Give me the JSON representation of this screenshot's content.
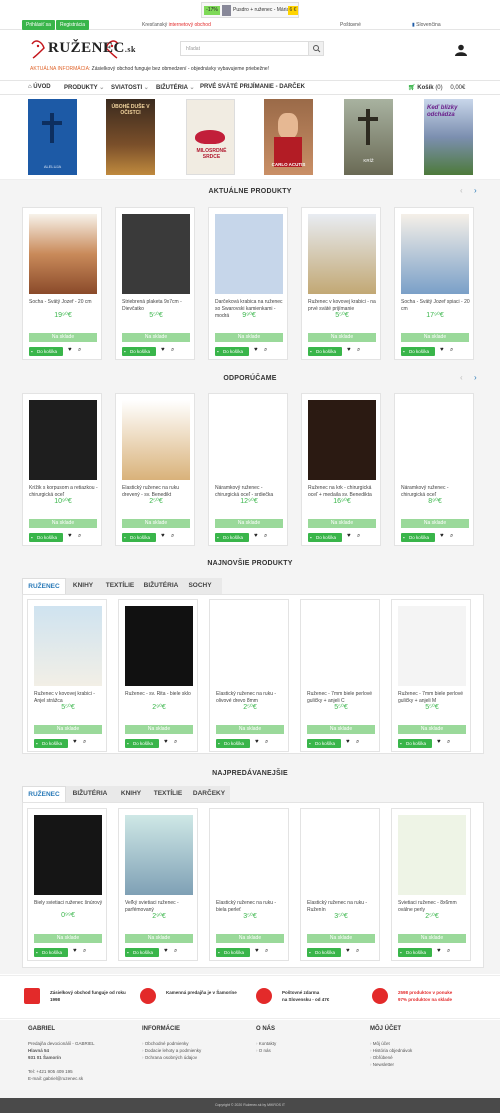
{
  "topbar": {
    "login": "Prihlásiť sa",
    "register": "Registrácia",
    "tagline": "Kresťanský ",
    "tagline_accent": "internetový obchod",
    "shipping": "Poštovné",
    "language": "Slovenčina",
    "promo_discount": "-17%",
    "promo_text": "Pusdro + ruženec - Mária",
    "promo_price": "6 €"
  },
  "colors": {
    "green": "#39b54a",
    "light_green": "#9ad99a",
    "red": "#e32a2a",
    "orange": "#e0662d",
    "blue": "#2a7ab8"
  },
  "header": {
    "logo_text": "RUŽENEC",
    "logo_suffix": ".sk",
    "search_placeholder": "hľadat",
    "notice_label": "AKTUÁLNA INFORMÁCIA:",
    "notice_text": " Zásielkový obchod funguje bez obmedzení - objednávky vybavujeme priebežne!"
  },
  "nav": {
    "items": [
      "ÚVOD",
      "PRODUKTY",
      "SVIATOSTI",
      "BIŽUTÉRIA",
      "PRVÉ SVÄTÉ PRIJÍMANIE - DARČEK"
    ],
    "cart_label": "Košík",
    "cart_count": "(0)",
    "cart_total": "0,00€"
  },
  "books": [
    {
      "title": "ALELUJA",
      "color": "#1d5aa6"
    },
    {
      "title": "ÚBOHÉ DUŠE V OČISTCI",
      "color": "#5a3a22"
    },
    {
      "title": "MILOSRDNÉ SRDCE",
      "color": "#f1ece2"
    },
    {
      "title": "CARLO ACUTIS",
      "color": "#b57a4c"
    },
    {
      "title": "KRÍŽ",
      "color": "#6a6a55"
    },
    {
      "title": "Keď blízky odchádza",
      "color": "#6b7b9a"
    }
  ],
  "sections": {
    "current": "AKTUÁLNE PRODUKTY",
    "recommended": "ODPORÚČAME",
    "newest": "NAJNOVŠIE PRODUKTY",
    "bestsellers": "NAJPREDÁVANEJŠIE"
  },
  "labels": {
    "in_stock": "Na sklade",
    "to_cart": "Do košíka",
    "heart_icon": "♥",
    "search_icon": "⌕"
  },
  "current_products": [
    {
      "name": "Socha - Svätý Jozef - 20 cm",
      "price": "19⁹⁰€"
    },
    {
      "name": "Striebrená plaketa 9x7cm - Dievčatko",
      "price": "5⁵⁰€"
    },
    {
      "name": "Darčeková krabica na ruženec so Swarovski kamienkami - modrá",
      "price": "9⁹⁰€"
    },
    {
      "name": "Ruženec v kovovej krabici - na prvé sväté prijímanie",
      "price": "5⁵⁰€"
    },
    {
      "name": "Socha - Svätý Jozef spiaci - 20 cm",
      "price": "17⁹⁰€"
    }
  ],
  "recommended_products": [
    {
      "name": "Krížik s korpusom a retiazkou - chirurgická oceľ",
      "price": "10⁹⁰€"
    },
    {
      "name": "Elastický ruženec na ruku drevený - sv. Benedikt",
      "price": "2⁵⁰€"
    },
    {
      "name": "Náramkový ruženec - chirurgická oceľ - srdiečka",
      "price": "12⁹⁰€"
    },
    {
      "name": "Ruženec na krk - chirurgická oceľ + medaila sv. Benedikta",
      "price": "16⁹⁰€"
    },
    {
      "name": "Náramkový ruženec - chirurgická oceľ",
      "price": "8⁹⁰€"
    }
  ],
  "newest_tabs": [
    "RUŽENEC",
    "KNIHY",
    "TEXTÍLIE",
    "BIŽUTÉRIA",
    "SOCHY"
  ],
  "newest_products": [
    {
      "name": "Ruženec v kovovej krabici - Anjel strážca",
      "price": "5⁵⁰€"
    },
    {
      "name": "Ruženec - sv. Rita - biele sklo",
      "price": "2⁹⁰€"
    },
    {
      "name": "Elastický ruženec na ruku - olivové drevo 8mm",
      "price": "2⁵⁰€"
    },
    {
      "name": "Ruženec - 7mm biele perlové guličky + anjeli C",
      "price": "5⁵⁰€"
    },
    {
      "name": "Ruženec - 7mm biele perlové guličky + anjeli M",
      "price": "5⁵⁰€"
    }
  ],
  "best_tabs": [
    "RUŽENEC",
    "BIŽUTÉRIA",
    "KNIHY",
    "TEXTÍLIE",
    "DARČEKY"
  ],
  "best_products": [
    {
      "name": "Biely svietiaci ruženec šnúrový",
      "price": "0⁹⁹€"
    },
    {
      "name": "Veľký svietiaci ruženec - parfémovaný",
      "price": "2⁹⁰€"
    },
    {
      "name": "Elastický ruženec na ruku - biela perleť",
      "price": "3⁵⁰€"
    },
    {
      "name": "Elastický ruženec na ruku - Ruženín",
      "price": "3⁵⁰€"
    },
    {
      "name": "Svietiaci ruženec - 8x6mm oválne perly",
      "price": "2⁵⁰€"
    }
  ],
  "features": [
    {
      "line1": "Zásielkový obchod funguje od roku",
      "line2": "1998"
    },
    {
      "line1": "Kamenná predajňa je v Šamoríne",
      "line2": ""
    },
    {
      "line1": "Poštovné zdarma",
      "line2": "na Slovensku - od 47€"
    },
    {
      "line1": "2598 produktov v ponuke",
      "line2": "97% produktov na sklade"
    }
  ],
  "footer": {
    "col1_title": "GABRIEL",
    "col1_lines": [
      "Predajňa devocionálií - GABRIEL",
      "Hlavná 54",
      "931 01 Šamorín",
      "",
      "Tel: +421 905 409 195",
      "E-mail: gabriel@ruzenec.sk"
    ],
    "col2_title": "INFORMÁCIE",
    "col2_lines": [
      "Obchodné podmienky",
      "Dodacie lehoty a podmienky",
      "Ochrana osobných údajov"
    ],
    "col3_title": "O NÁS",
    "col3_lines": [
      "Kontakty",
      "O nás"
    ],
    "col4_title": "MÔJ ÚČET",
    "col4_lines": [
      "Môj účet",
      "História objednávok",
      "Obľúbené",
      "Newsletter"
    ],
    "copyright": "Copyright © 2020 Ruženec.sk by MIKROS IT"
  }
}
